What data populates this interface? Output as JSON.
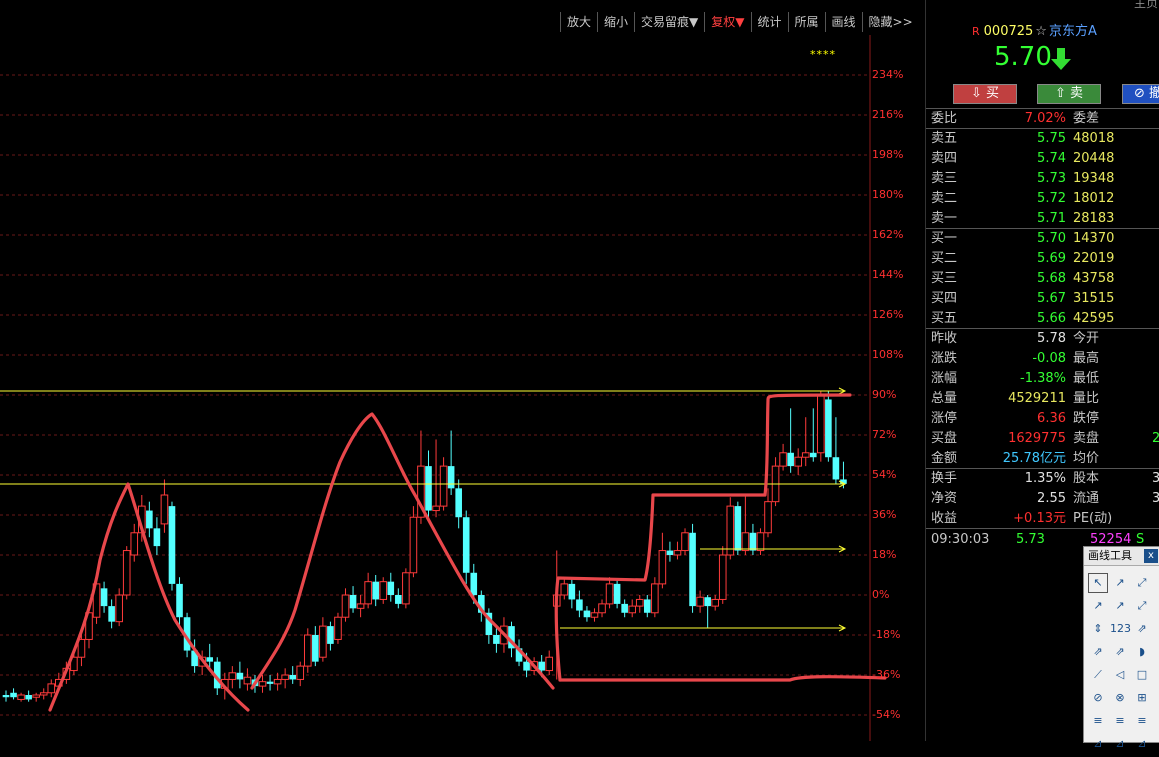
{
  "toolbar": [
    "放大",
    "缩小",
    "交易留痕▼",
    "复权▼",
    "统计",
    "所属",
    "画线",
    "隐藏>>"
  ],
  "stars": "****",
  "axis_labels": [
    "234%",
    "216%",
    "198%",
    "180%",
    "162%",
    "144%",
    "126%",
    "108%",
    "90%",
    "72%",
    "54%",
    "36%",
    "18%",
    "0%",
    "-18%",
    "-36%",
    "-54%"
  ],
  "top_right_text": "主页",
  "stock": {
    "r": "R",
    "code": "000725",
    "name": "京东方A",
    "price": "5.70",
    "arrow_color": "#33dd33"
  },
  "trade_buttons": {
    "buy": "买",
    "sell": "卖",
    "cancel": "撤"
  },
  "weibi": {
    "label": "委比",
    "value": "7.02%",
    "label2": "委差"
  },
  "asks": [
    {
      "label": "卖五",
      "price": "5.75",
      "vol": "48018"
    },
    {
      "label": "卖四",
      "price": "5.74",
      "vol": "20448"
    },
    {
      "label": "卖三",
      "price": "5.73",
      "vol": "19348"
    },
    {
      "label": "卖二",
      "price": "5.72",
      "vol": "18012"
    },
    {
      "label": "卖一",
      "price": "5.71",
      "vol": "28183"
    }
  ],
  "bids": [
    {
      "label": "买一",
      "price": "5.70",
      "vol": "14370"
    },
    {
      "label": "买二",
      "price": "5.69",
      "vol": "22019"
    },
    {
      "label": "买三",
      "price": "5.68",
      "vol": "43758"
    },
    {
      "label": "买四",
      "price": "5.67",
      "vol": "31515"
    },
    {
      "label": "买五",
      "price": "5.66",
      "vol": "42595"
    }
  ],
  "quote": [
    {
      "label": "昨收",
      "value": "5.78",
      "color": "white",
      "label2": "今开"
    },
    {
      "label": "涨跌",
      "value": "-0.08",
      "color": "green",
      "label2": "最高"
    },
    {
      "label": "涨幅",
      "value": "-1.38%",
      "color": "green",
      "label2": "最低"
    },
    {
      "label": "总量",
      "value": "4529211",
      "color": "yellow",
      "label2": "量比"
    },
    {
      "label": "涨停",
      "value": "6.36",
      "color": "red",
      "label2": "跌停"
    },
    {
      "label": "买盘",
      "value": "1629775",
      "color": "red",
      "label2": "卖盘",
      "value2": "2"
    },
    {
      "label": "金额",
      "value": "25.78亿元",
      "color": "cyan",
      "label2": "均价"
    }
  ],
  "fundamentals": [
    {
      "label": "换手",
      "value": "1.35%",
      "color": "white",
      "label2": "股本",
      "value2": "3"
    },
    {
      "label": "净资",
      "value": "2.55",
      "color": "white",
      "label2": "流通",
      "value2": "3"
    },
    {
      "label": "收益",
      "value": "+0.13元",
      "color": "red",
      "label2": "PE(动)"
    }
  ],
  "tick": {
    "time": "09:30:03",
    "price": "5.73",
    "vol": "52254",
    "side": "S"
  },
  "draw_tools": {
    "title": "画线工具",
    "close": "x",
    "tools": [
      "↖",
      "↗",
      "⤢",
      "↗",
      "↗",
      "⤢",
      "⇕",
      "123",
      "⇗",
      "⇗",
      "⇗",
      "◗",
      "⟋",
      "◁",
      "□",
      "⊘",
      "⊗",
      "⊞",
      "≡",
      "≡",
      "≡",
      "⊿",
      "⊿",
      "⊿"
    ]
  },
  "chart_data": {
    "type": "candlestick",
    "price_axis": "percent",
    "ylim": [
      -60,
      245
    ],
    "candles": [
      [
        -45,
        -46,
        -43,
        -48
      ],
      [
        -44,
        -46,
        -42,
        -47
      ],
      [
        -47,
        -45,
        -44,
        -48
      ],
      [
        -45,
        -47,
        -43,
        -48
      ],
      [
        -46,
        -45,
        -44,
        -48
      ],
      [
        -45,
        -44,
        -42,
        -47
      ],
      [
        -44,
        -40,
        -38,
        -46
      ],
      [
        -41,
        -38,
        -35,
        -43
      ],
      [
        -38,
        -33,
        -30,
        -40
      ],
      [
        -34,
        -28,
        -25,
        -36
      ],
      [
        -28,
        -20,
        -15,
        -32
      ],
      [
        -20,
        -8,
        -4,
        -24
      ],
      [
        -10,
        5,
        8,
        -13
      ],
      [
        3,
        -5,
        6,
        -8
      ],
      [
        -5,
        -12,
        -2,
        -15
      ],
      [
        -12,
        0,
        3,
        -14
      ],
      [
        0,
        20,
        22,
        -2
      ],
      [
        18,
        28,
        32,
        15
      ],
      [
        28,
        40,
        45,
        24
      ],
      [
        38,
        30,
        42,
        26
      ],
      [
        30,
        22,
        35,
        18
      ],
      [
        32,
        45,
        52,
        28
      ],
      [
        40,
        5,
        42,
        2
      ],
      [
        5,
        -10,
        8,
        -14
      ],
      [
        -10,
        -25,
        -8,
        -28
      ],
      [
        -25,
        -32,
        -20,
        -35
      ],
      [
        -32,
        -28,
        -25,
        -36
      ],
      [
        -28,
        -30,
        -22,
        -34
      ],
      [
        -30,
        -42,
        -28,
        -45
      ],
      [
        -42,
        -38,
        -35,
        -47
      ],
      [
        -38,
        -35,
        -32,
        -42
      ],
      [
        -35,
        -38,
        -30,
        -42
      ],
      [
        -40,
        -37,
        -33,
        -43
      ],
      [
        -38,
        -41,
        -36,
        -44
      ],
      [
        -41,
        -39,
        -36,
        -44
      ],
      [
        -39,
        -40,
        -36,
        -43
      ],
      [
        -40,
        -38,
        -35,
        -43
      ],
      [
        -38,
        -36,
        -33,
        -42
      ],
      [
        -36,
        -38,
        -32,
        -40
      ],
      [
        -38,
        -32,
        -30,
        -41
      ],
      [
        -32,
        -18,
        -15,
        -35
      ],
      [
        -18,
        -30,
        -14,
        -32
      ],
      [
        -28,
        -14,
        -10,
        -30
      ],
      [
        -14,
        -22,
        -12,
        -25
      ],
      [
        -20,
        -10,
        -8,
        -22
      ],
      [
        -10,
        0,
        3,
        -12
      ],
      [
        0,
        -6,
        4,
        -8
      ],
      [
        -6,
        -4,
        0,
        -10
      ],
      [
        -4,
        6,
        10,
        -6
      ],
      [
        6,
        -2,
        9,
        -5
      ],
      [
        -2,
        6,
        8,
        -4
      ],
      [
        6,
        0,
        10,
        -3
      ],
      [
        0,
        -4,
        3,
        -6
      ],
      [
        -4,
        10,
        12,
        -6
      ],
      [
        10,
        35,
        40,
        8
      ],
      [
        35,
        58,
        74,
        32
      ],
      [
        58,
        38,
        65,
        34
      ],
      [
        38,
        40,
        70,
        35
      ],
      [
        40,
        58,
        62,
        38
      ],
      [
        58,
        48,
        74,
        45
      ],
      [
        48,
        35,
        52,
        30
      ],
      [
        35,
        10,
        38,
        5
      ],
      [
        10,
        0,
        14,
        -4
      ],
      [
        0,
        -8,
        2,
        -12
      ],
      [
        -8,
        -18,
        -6,
        -22
      ],
      [
        -18,
        -22,
        -15,
        -26
      ],
      [
        -22,
        -14,
        -10,
        -26
      ],
      [
        -14,
        -24,
        -12,
        -28
      ],
      [
        -24,
        -30,
        -20,
        -32
      ],
      [
        -30,
        -34,
        -26,
        -37
      ],
      [
        -34,
        -30,
        -28,
        -36
      ],
      [
        -30,
        -34,
        -27,
        -37
      ],
      [
        -34,
        -28,
        -25,
        -36
      ],
      [
        -5,
        0,
        20,
        -38
      ],
      [
        0,
        5,
        8,
        -2
      ],
      [
        5,
        -2,
        7,
        -6
      ],
      [
        -2,
        -7,
        2,
        -10
      ],
      [
        -7,
        -10,
        -5,
        -12
      ],
      [
        -10,
        -8,
        -6,
        -12
      ],
      [
        -8,
        -4,
        -2,
        -10
      ],
      [
        -4,
        5,
        8,
        -6
      ],
      [
        5,
        -4,
        7,
        -6
      ],
      [
        -4,
        -8,
        -2,
        -10
      ],
      [
        -8,
        -5,
        -2,
        -10
      ],
      [
        -5,
        -2,
        0,
        -8
      ],
      [
        -2,
        -8,
        0,
        -10
      ],
      [
        -8,
        5,
        8,
        -10
      ],
      [
        5,
        20,
        28,
        3
      ],
      [
        20,
        18,
        24,
        15
      ],
      [
        18,
        20,
        24,
        16
      ],
      [
        20,
        28,
        30,
        18
      ],
      [
        28,
        -5,
        32,
        -8
      ],
      [
        -5,
        -1,
        2,
        -8
      ],
      [
        -1,
        -5,
        0,
        -15
      ],
      [
        -5,
        -2,
        0,
        -7
      ],
      [
        -2,
        18,
        22,
        -4
      ],
      [
        18,
        40,
        44,
        16
      ],
      [
        40,
        20,
        42,
        18
      ],
      [
        20,
        28,
        45,
        18
      ],
      [
        28,
        20,
        32,
        18
      ],
      [
        20,
        28,
        30,
        18
      ],
      [
        28,
        42,
        48,
        26
      ],
      [
        42,
        58,
        62,
        40
      ],
      [
        58,
        64,
        68,
        56
      ],
      [
        64,
        58,
        84,
        55
      ],
      [
        58,
        62,
        66,
        54
      ],
      [
        62,
        64,
        80,
        58
      ],
      [
        64,
        62,
        84,
        60
      ],
      [
        64,
        90,
        92,
        60
      ],
      [
        88,
        62,
        92,
        60
      ],
      [
        62,
        52,
        80,
        50
      ],
      [
        52,
        50,
        60,
        48
      ]
    ]
  }
}
